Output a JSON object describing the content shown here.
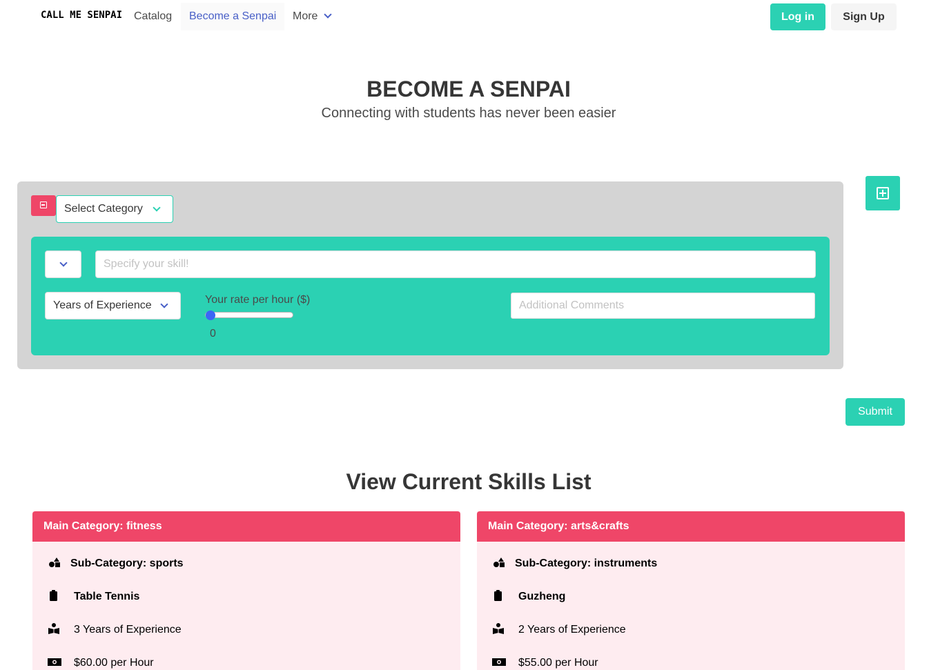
{
  "navbar": {
    "brand": "CALL ME SENPAI",
    "items": [
      {
        "label": "Catalog"
      },
      {
        "label": "Become a Senpai",
        "active": true
      },
      {
        "label": "More"
      }
    ],
    "login_label": "Log in",
    "signup_label": "Sign Up"
  },
  "hero": {
    "title": "BECOME A SENPAI",
    "subtitle": "Connecting with students has never been easier"
  },
  "form": {
    "category_select": "Select Category",
    "skill_placeholder": "Specify your skill!",
    "years_select": "Years of Experience",
    "rate_label": "Your rate per hour ($)",
    "rate_value": "0",
    "comments_placeholder": "Additional Comments",
    "submit_label": "Submit"
  },
  "skills_list": {
    "title": "View Current Skills List",
    "cards": [
      {
        "main_category": "Main Category: fitness",
        "sub_category": "Sub-Category: sports",
        "skill": "Table Tennis",
        "experience": "3 Years of Experience",
        "rate": "$60.00 per Hour"
      },
      {
        "main_category": "Main Category: arts&crafts",
        "sub_category": "Sub-Category: instruments",
        "skill": "Guzheng",
        "experience": "2 Years of Experience",
        "rate": "$55.00 per Hour"
      }
    ]
  },
  "colors": {
    "primary": "#2bd1b3",
    "danger": "#ef4668",
    "link": "#485fc7",
    "card_bg": "#feecf0",
    "panel_bg": "#d4d4d4"
  }
}
